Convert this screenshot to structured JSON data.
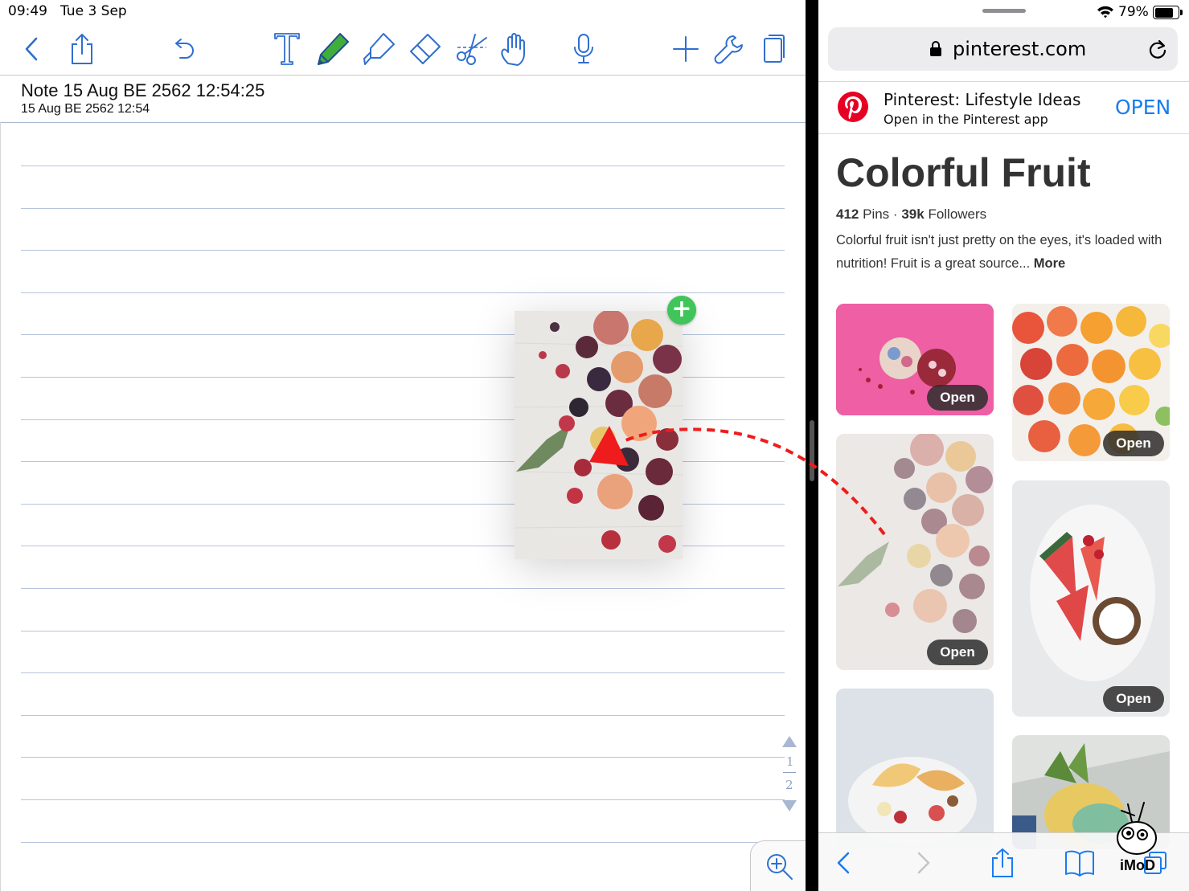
{
  "status": {
    "time": "09:49",
    "date": "Tue 3 Sep",
    "battery": "79%"
  },
  "note": {
    "title": "Note 15 Aug BE 2562 12:54:25",
    "date": "15 Aug BE 2562 12:54",
    "pages": [
      "1",
      "2"
    ]
  },
  "toolbar": {
    "icons": [
      "back-icon",
      "share-icon",
      "undo-icon",
      "text-tool-icon",
      "pen-icon",
      "highlighter-icon",
      "eraser-icon",
      "scissors-icon",
      "hand-icon",
      "microphone-icon",
      "add-icon",
      "wrench-icon",
      "pages-icon"
    ],
    "active_color": "#3fae3a",
    "accent": "#2f6fd0"
  },
  "browser": {
    "url": "pinterest.com",
    "banner": {
      "title": "Pinterest: Lifestyle Ideas",
      "subtitle": "Open in the Pinterest app",
      "open_label": "OPEN"
    },
    "board": {
      "title": "Colorful Fruit",
      "pins_count": "412",
      "pins_label": "Pins",
      "followers_count": "39k",
      "followers_label": "Followers",
      "separator": "·",
      "description": "Colorful fruit isn't just pretty on the eyes, it's loaded with nutrition! Fruit is a great source...",
      "more_label": "More"
    },
    "pins": [
      {
        "open_label": "Open"
      },
      {
        "open_label": "Open"
      },
      {
        "open_label": "Open"
      },
      {
        "open_label": "Open"
      }
    ],
    "brand_color": "#e60023"
  },
  "watermark": "iMoD"
}
